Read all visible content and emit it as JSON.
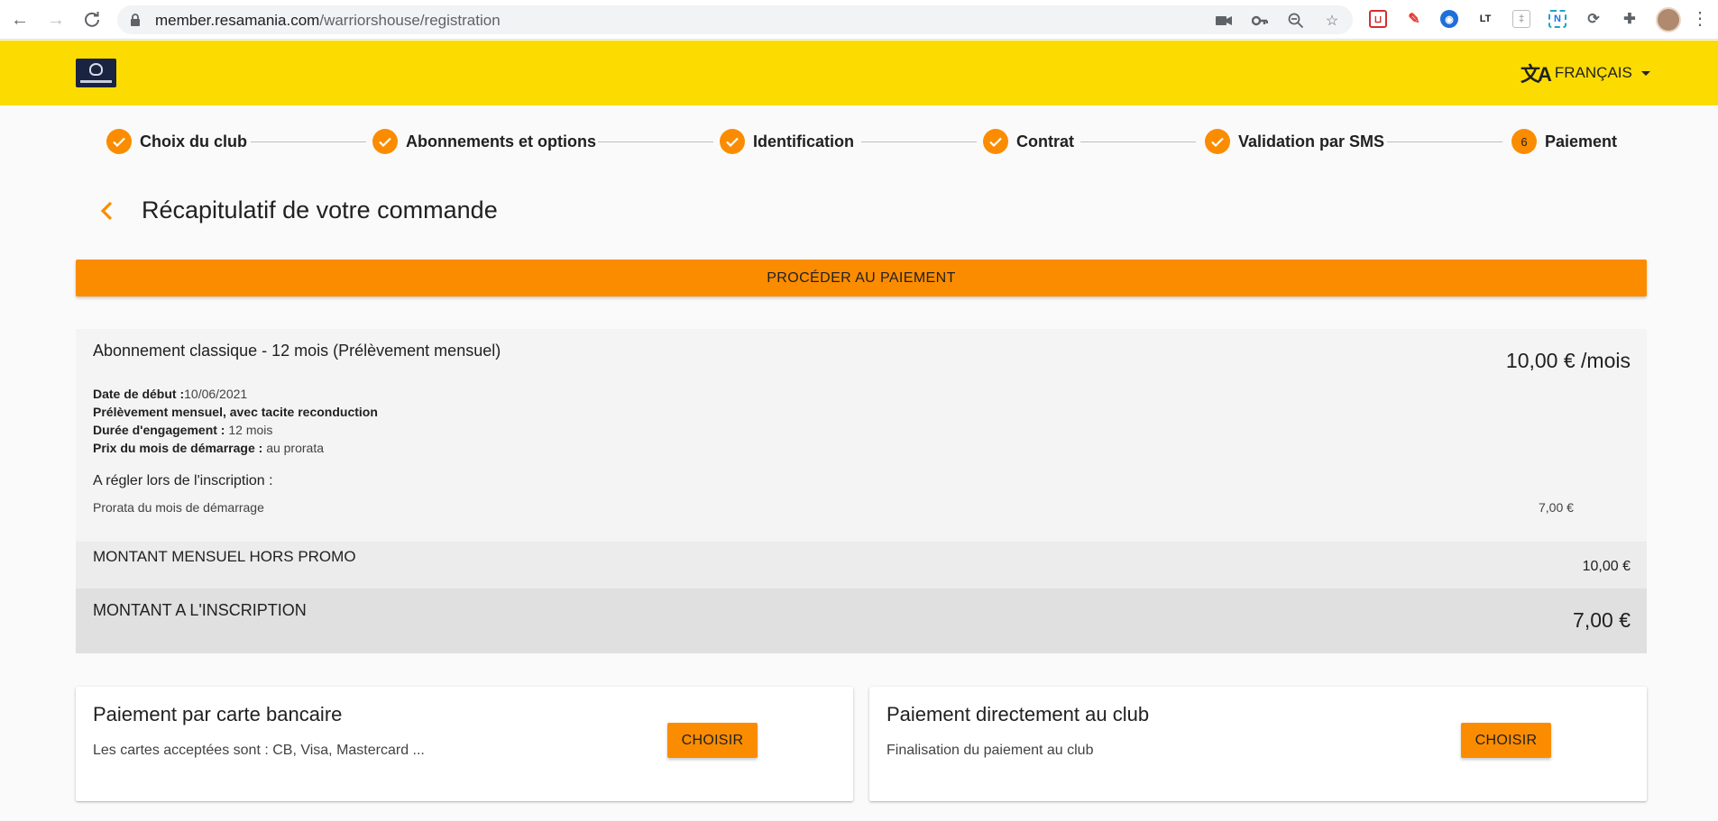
{
  "browser": {
    "url_host": "member.resamania.com",
    "url_path": "/warriorshouse/registration"
  },
  "header": {
    "language": "FRANÇAIS"
  },
  "stepper": {
    "steps": [
      {
        "label": "Choix du club",
        "status": "done"
      },
      {
        "label": "Abonnements et options",
        "status": "done"
      },
      {
        "label": "Identification",
        "status": "done"
      },
      {
        "label": "Contrat",
        "status": "done"
      },
      {
        "label": "Validation par SMS",
        "status": "done"
      },
      {
        "label": "Paiement",
        "status": "current",
        "number": "6"
      }
    ]
  },
  "page": {
    "title": "Récapitulatif de votre commande",
    "pay_button": "PROCÉDER AU PAIEMENT"
  },
  "summary": {
    "title": "Abonnement classique - 12 mois (Prélèvement mensuel)",
    "price": "10,00 € /mois",
    "start_label": "Date de début :",
    "start_value": "10/06/2021",
    "debit_label": "Prélèvement mensuel, avec tacite reconduction",
    "duration_label": "Durée d'engagement :",
    "duration_value": "12 mois",
    "first_month_label": "Prix du mois de démarrage :",
    "first_month_value": "au prorata",
    "to_pay_title": "A régler lors de l'inscription :",
    "prorata_label": "Prorata du mois de démarrage",
    "prorata_value": "7,00 €",
    "monthly_label": "MONTANT MENSUEL HORS PROMO",
    "monthly_value": "10,00 €",
    "total_label": "MONTANT A L'INSCRIPTION",
    "total_value": "7,00 €"
  },
  "payment_options": [
    {
      "title": "Paiement par carte bancaire",
      "desc": "Les cartes acceptées sont : CB, Visa, Mastercard ...",
      "button": "CHOISIR"
    },
    {
      "title": "Paiement directement au club",
      "desc": "Finalisation du paiement au club",
      "button": "CHOISIR"
    }
  ],
  "colors": {
    "header_yellow": "#fcdc00",
    "accent_orange": "#fb8c00"
  }
}
